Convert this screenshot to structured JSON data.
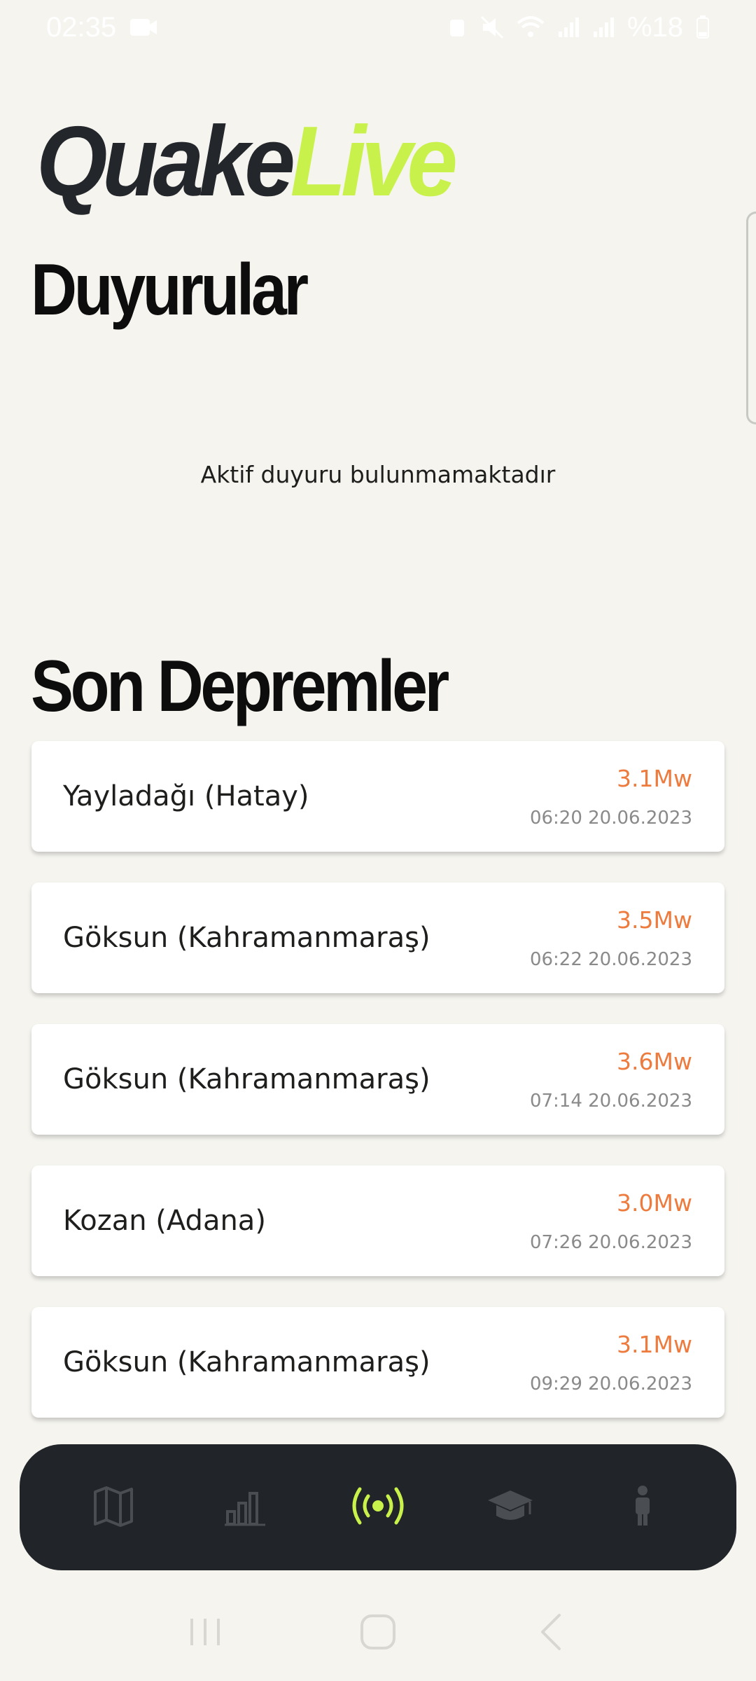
{
  "status_bar": {
    "time": "02:35",
    "battery_text": "%18",
    "icons": [
      "video-camera-icon",
      "alarm-icon",
      "mute-icon",
      "wifi-icon",
      "signal-icon",
      "signal-icon",
      "battery-icon"
    ]
  },
  "brand": {
    "part1": "Quake",
    "part2": "Live",
    "accent": "#c9f14b"
  },
  "announcements": {
    "title": "Duyurular",
    "empty_text": "Aktif duyuru bulunmamaktadır"
  },
  "recent": {
    "title": "Son Depremler",
    "items": [
      {
        "place": "Yayladağı (Hatay)",
        "magnitude": "3.1Mw",
        "datetime": "06:20 20.06.2023"
      },
      {
        "place": "Göksun (Kahramanmaraş)",
        "magnitude": "3.5Mw",
        "datetime": "06:22 20.06.2023"
      },
      {
        "place": "Göksun (Kahramanmaraş)",
        "magnitude": "3.6Mw",
        "datetime": "07:14 20.06.2023"
      },
      {
        "place": "Kozan (Adana)",
        "magnitude": "3.0Mw",
        "datetime": "07:26 20.06.2023"
      },
      {
        "place": "Göksun (Kahramanmaraş)",
        "magnitude": "3.1Mw",
        "datetime": "09:29 20.06.2023"
      }
    ]
  },
  "bottom_nav": {
    "items": [
      {
        "icon": "map-icon",
        "active": false
      },
      {
        "icon": "bar-chart-icon",
        "active": false
      },
      {
        "icon": "broadcast-icon",
        "active": true
      },
      {
        "icon": "graduation-cap-icon",
        "active": false
      },
      {
        "icon": "person-icon",
        "active": false
      }
    ],
    "active_color": "#c9f14b",
    "inactive_color": "#4a4d52"
  },
  "colors": {
    "magnitude": "#ee7b3e",
    "background": "#f5f4ef",
    "nav_bg": "#212428"
  }
}
